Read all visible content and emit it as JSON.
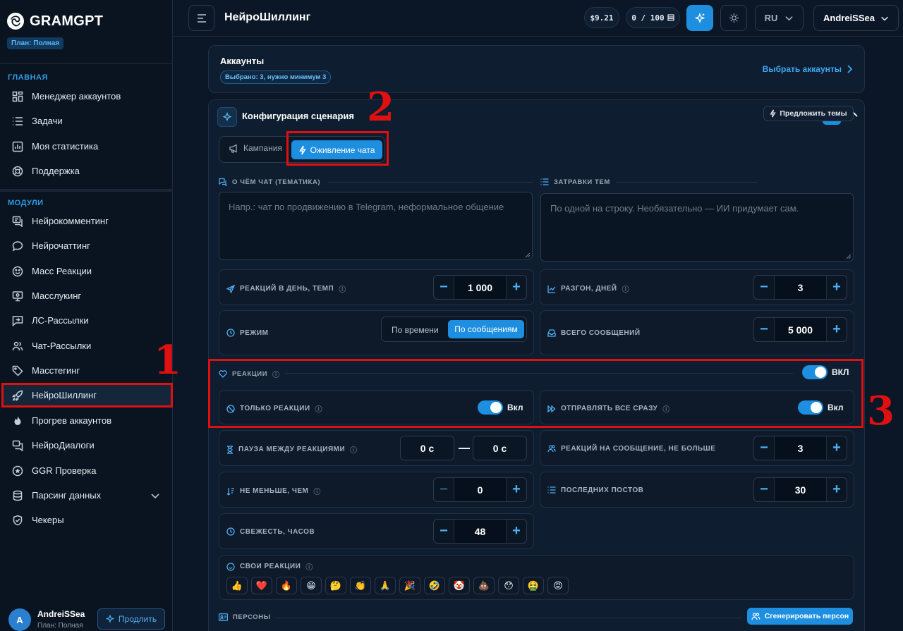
{
  "sidebar": {
    "brand": "GRAMGPT",
    "plan_badge": "План: Полная",
    "section_main": "ГЛАВНАЯ",
    "main_items": [
      {
        "label": "Менеджер аккаунтов"
      },
      {
        "label": "Задачи"
      },
      {
        "label": "Моя статистика"
      },
      {
        "label": "Поддержка"
      }
    ],
    "section_modules": "МОДУЛИ",
    "module_items": [
      {
        "label": "Нейрокомментинг"
      },
      {
        "label": "Нейрочаттинг"
      },
      {
        "label": "Масс Реакции"
      },
      {
        "label": "Масслукинг"
      },
      {
        "label": "ЛС-Рассылки"
      },
      {
        "label": "Чат-Рассылки"
      },
      {
        "label": "Масстегинг"
      },
      {
        "label": "НейроШиллинг",
        "active": true
      },
      {
        "label": "Прогрев аккаунтов"
      },
      {
        "label": "НейроДиалоги"
      },
      {
        "label": "GGR Проверка"
      },
      {
        "label": "Парсинг данных"
      },
      {
        "label": "Чекеры"
      }
    ],
    "user": {
      "initial": "A",
      "name": "AndreiSSea",
      "plan": "План: Полная",
      "renew_label": "Продлить"
    }
  },
  "header": {
    "title": "НейроШиллинг",
    "balance": "$9.21",
    "quota": "0 / 100",
    "language": "RU",
    "username": "AndreiSSea"
  },
  "accounts": {
    "title": "Аккаунты",
    "badge": "Выбрано: 3, нужно минимум 3",
    "select_link": "Выбрать аккаунты"
  },
  "config": {
    "title": "Конфигурация сценария",
    "tabs": {
      "campaign": "Кампания",
      "chat_revival": "Оживление чата",
      "active": "chat_revival"
    },
    "topic": {
      "label": "О ЧЁМ ЧАТ (ТЕМАТИКА)",
      "placeholder": "Напр.: чат по продвижению в Telegram, неформальное общение"
    },
    "starters": {
      "label": "ЗАТРАВКИ ТЕМ",
      "suggest": "Предложить темы",
      "placeholder": "По одной на строку. Необязательно — ИИ придумает сам."
    },
    "reactions_per_day": {
      "label": "РЕАКЦИЙ В ДЕНЬ, ТЕМП",
      "value": "1 000"
    },
    "ramp_days": {
      "label": "РАЗГОН, ДНЕЙ",
      "value": "3"
    },
    "mode": {
      "label": "РЕЖИМ",
      "by_time": "По времени",
      "by_messages": "По сообщениям",
      "active": "by_messages"
    },
    "total_messages": {
      "label": "ВСЕГО СООБЩЕНИЙ",
      "value": "5 000"
    },
    "reactions": {
      "label": "РЕАКЦИИ",
      "toggle_label": "ВКЛ",
      "enabled": true
    },
    "only_reactions": {
      "label": "ТОЛЬКО РЕАКЦИИ",
      "toggle_label": "Вкл",
      "enabled": true
    },
    "send_all_at_once": {
      "label": "ОТПРАВЛЯТЬ ВСЕ СРАЗУ",
      "toggle_label": "Вкл",
      "enabled": true
    },
    "pause": {
      "label": "ПАУЗА МЕЖДУ РЕАКЦИЯМИ",
      "from": "0 с",
      "to": "0 с"
    },
    "reactions_per_message": {
      "label": "РЕАКЦИЙ НА СООБЩЕНИЕ, НЕ БОЛЬШЕ",
      "value": "3"
    },
    "not_less_than": {
      "label": "НЕ МЕНЬШЕ, ЧЕМ",
      "value": "0"
    },
    "last_posts": {
      "label": "ПОСЛЕДНИХ ПОСТОВ",
      "value": "30"
    },
    "freshness": {
      "label": "СВЕЖЕСТЬ, ЧАСОВ",
      "value": "48"
    },
    "custom_reactions": {
      "label": "СВОИ РЕАКЦИИ",
      "emojis": [
        "👍",
        "❤️",
        "🔥",
        "😁",
        "🤔",
        "👏",
        "🙏",
        "🎉",
        "🤣",
        "🤡",
        "💩",
        "😯",
        "🤮",
        "😡"
      ]
    },
    "personas": {
      "label": "ПЕРСОНЫ",
      "generate": "Сгенерировать персон"
    }
  },
  "annotations": [
    "1",
    "2",
    "3"
  ]
}
